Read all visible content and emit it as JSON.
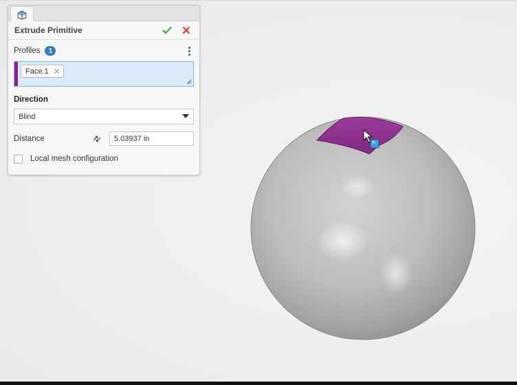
{
  "feature": {
    "title": "Extrude Primitive",
    "tab_icon": "extrude-feature-icon",
    "accept_icon": "check-icon",
    "cancel_icon": "close-icon",
    "accept_color": "#3cab3c",
    "cancel_color": "#e0332a"
  },
  "profiles": {
    "label": "Profiles",
    "count": "1",
    "menu_icon": "more-vertical-icon",
    "chip_label": "Face.1",
    "chip_remove_icon": "close-icon",
    "accent_color": "#8e1f8f",
    "selection_bg": "#d8ebf7"
  },
  "direction": {
    "label": "Direction",
    "selected": "Blind",
    "dropdown_icon": "chevron-down-icon"
  },
  "distance": {
    "label": "Distance",
    "flip_icon": "flip-direction-icon",
    "value": "5.03937 in"
  },
  "local_mesh": {
    "label": "Local mesh configuration",
    "checked": false
  },
  "viewport": {
    "model": "sphere",
    "selected_face_color": "#8f2f8f",
    "cursor_icon": "arrow-cursor-icon"
  }
}
